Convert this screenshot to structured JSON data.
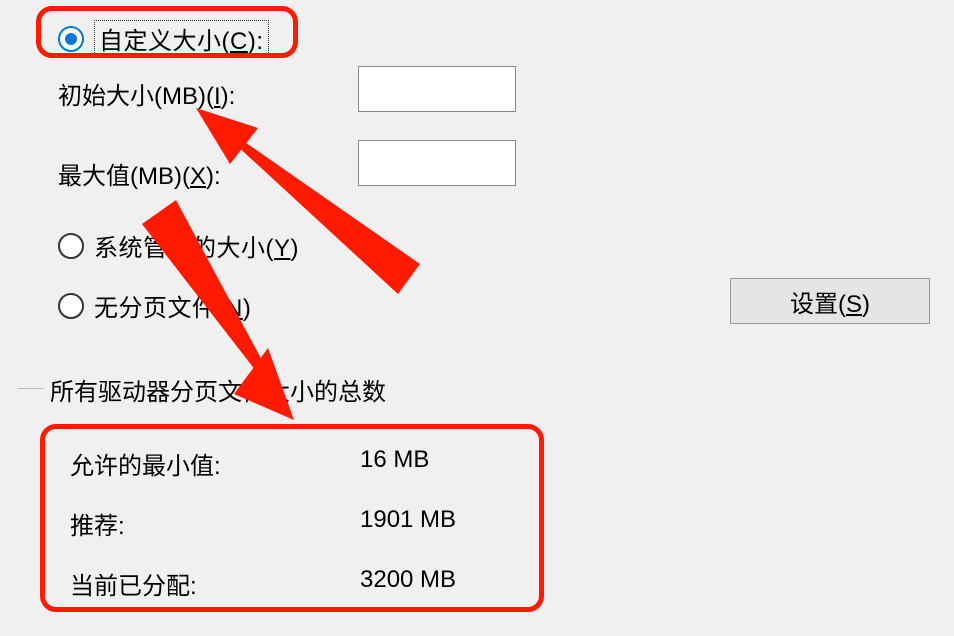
{
  "size_options": {
    "custom_size": {
      "label_pre": "自定义大小(",
      "key": "C",
      "label_post": "):"
    },
    "system_managed": {
      "label_pre": "系统管理的大小(",
      "key": "Y",
      "label_post": ")"
    },
    "no_paging": {
      "label_pre": "无分页文件(",
      "key": "N",
      "label_post": ")"
    }
  },
  "fields": {
    "initial": {
      "label_pre": "初始大小(MB)(",
      "key": "I",
      "label_post": "):"
    },
    "max": {
      "label_pre": "最大值(MB)(",
      "key": "X",
      "label_post": "):"
    }
  },
  "set_button": {
    "label_pre": "设置(",
    "key": "S",
    "label_post": ")"
  },
  "totals": {
    "title": "所有驱动器分页文件大小的总数",
    "min": {
      "label": "允许的最小值:",
      "value": "16 MB"
    },
    "recommended": {
      "label": "推荐:",
      "value": "1901 MB"
    },
    "allocated": {
      "label": "当前已分配:",
      "value": "3200 MB"
    }
  }
}
